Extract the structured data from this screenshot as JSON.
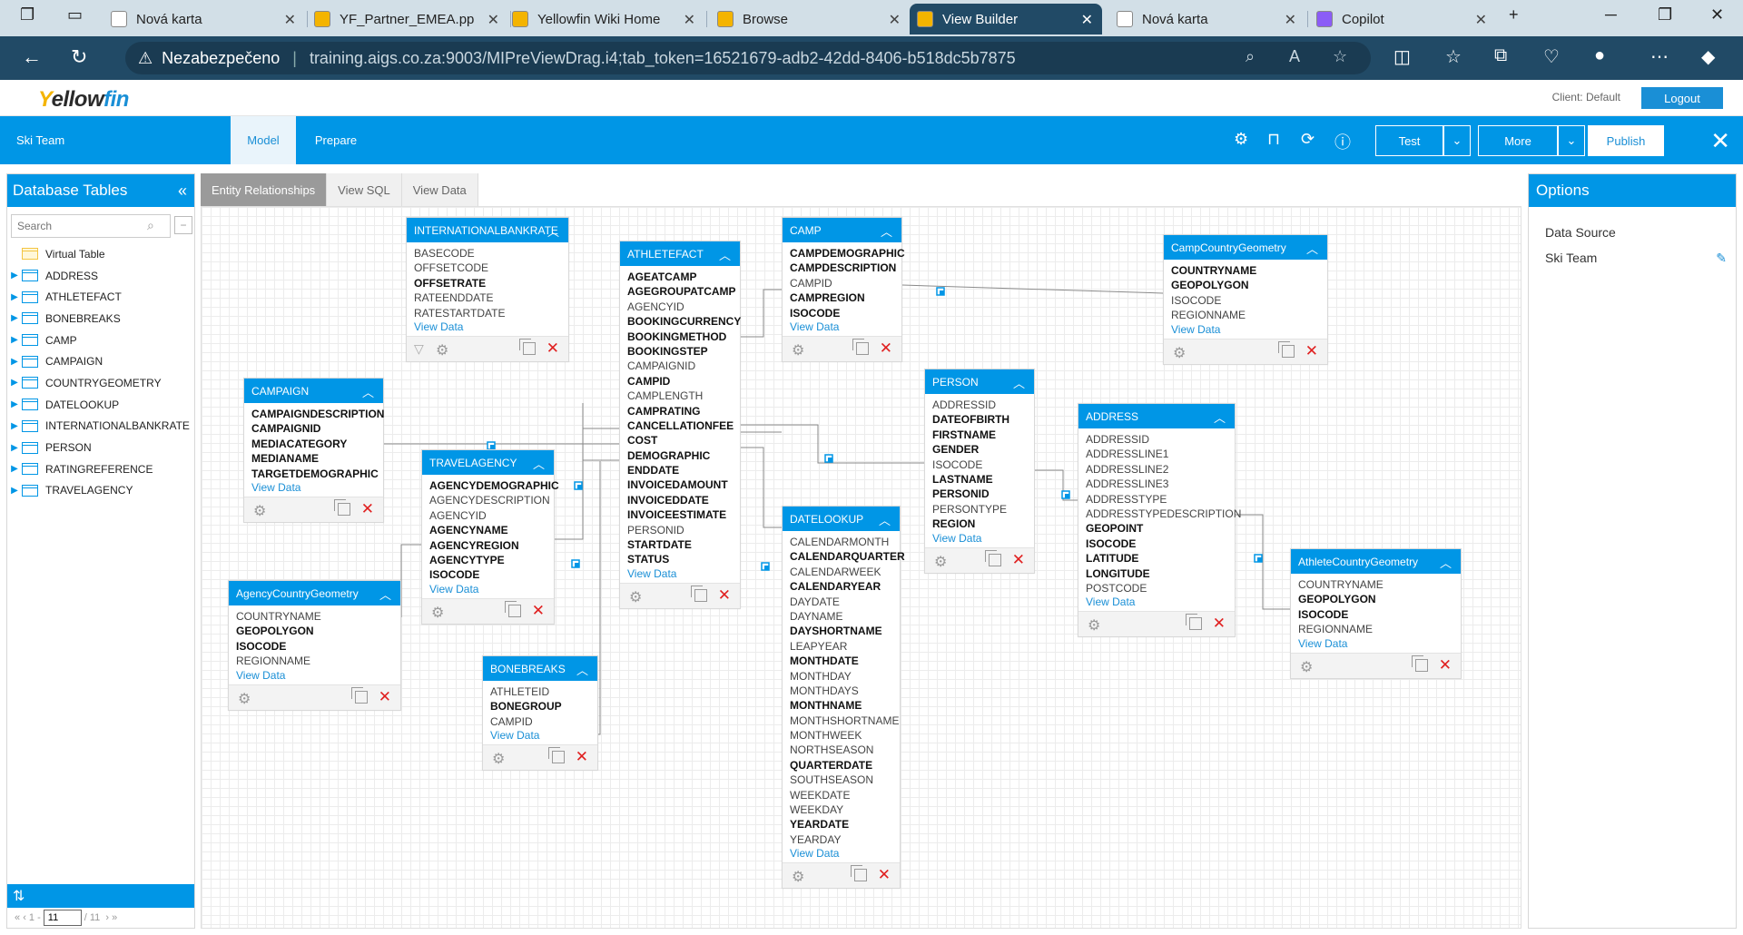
{
  "browser": {
    "tabs": [
      {
        "label": "Nová karta",
        "icon_color": "#ffffff"
      },
      {
        "label": "YF_Partner_EMEA.pp",
        "icon_color": "#f4b400"
      },
      {
        "label": "Yellowfin Wiki Home",
        "icon_color": "#f4b400"
      },
      {
        "label": "Browse",
        "icon_color": "#f4b400"
      },
      {
        "label": "View Builder",
        "icon_color": "#f4b400"
      },
      {
        "label": "Nová karta",
        "icon_color": "#ffffff"
      },
      {
        "label": "Copilot",
        "icon_color": "#8b5cf6"
      }
    ],
    "active_tab": 4,
    "security_label": "Nezabezpečeno",
    "url": "training.aigs.co.za:9003/MIPreViewDrag.i4;tab_token=16521679-adb2-42dd-8406-b518dc5b7875"
  },
  "app": {
    "logo_parts": [
      "Y",
      "ellow",
      "fin"
    ],
    "client_label": "Client: Default",
    "logout_label": "Logout",
    "view_name": "Ski Team",
    "tabs": [
      "Model",
      "Prepare"
    ],
    "active_tab": 0,
    "buttons": {
      "test": "Test",
      "more": "More",
      "publish": "Publish"
    }
  },
  "left_panel": {
    "title": "Database Tables",
    "search_placeholder": "Search",
    "items": [
      {
        "label": "Virtual Table",
        "folder": true
      },
      {
        "label": "ADDRESS"
      },
      {
        "label": "ATHLETEFACT"
      },
      {
        "label": "BONEBREAKS"
      },
      {
        "label": "CAMP"
      },
      {
        "label": "CAMPAIGN"
      },
      {
        "label": "COUNTRYGEOMETRY"
      },
      {
        "label": "DATELOOKUP"
      },
      {
        "label": "INTERNATIONALBANKRATE"
      },
      {
        "label": "PERSON"
      },
      {
        "label": "RATINGREFERENCE"
      },
      {
        "label": "TRAVELAGENCY"
      }
    ],
    "pager": {
      "page_prefix": "1 -",
      "page_value": "11",
      "page_total": "/ 11"
    }
  },
  "canvas": {
    "view_tabs": [
      "Entity Relationships",
      "View SQL",
      "View Data"
    ],
    "active_view_tab": 0,
    "view_data_label": "View Data",
    "entities": [
      {
        "id": "iban",
        "title": "INTERNATIONALBANKRATE",
        "filter": true,
        "fields": [
          [
            "BASECODE",
            0
          ],
          [
            "OFFSETCODE",
            0
          ],
          [
            "OFFSETRATE",
            1
          ],
          [
            "RATEENDDATE",
            0
          ],
          [
            "RATESTARTDATE",
            0
          ]
        ]
      },
      {
        "id": "athletefact",
        "title": "ATHLETEFACT",
        "fields": [
          [
            "AGEATCAMP",
            1
          ],
          [
            "AGEGROUPATCAMP",
            1
          ],
          [
            "AGENCYID",
            0
          ],
          [
            "BOOKINGCURRENCY",
            1
          ],
          [
            "BOOKINGMETHOD",
            1
          ],
          [
            "BOOKINGSTEP",
            1
          ],
          [
            "CAMPAIGNID",
            0
          ],
          [
            "CAMPID",
            1
          ],
          [
            "CAMPLENGTH",
            0
          ],
          [
            "CAMPRATING",
            1
          ],
          [
            "CANCELLATIONFEE",
            1
          ],
          [
            "COST",
            1
          ],
          [
            "DEMOGRAPHIC",
            1
          ],
          [
            "ENDDATE",
            1
          ],
          [
            "INVOICEDAMOUNT",
            1
          ],
          [
            "INVOICEDDATE",
            1
          ],
          [
            "INVOICEESTIMATE",
            1
          ],
          [
            "PERSONID",
            0
          ],
          [
            "STARTDATE",
            1
          ],
          [
            "STATUS",
            1
          ]
        ]
      },
      {
        "id": "camp",
        "title": "CAMP",
        "fields": [
          [
            "CAMPDEMOGRAPHIC",
            1
          ],
          [
            "CAMPDESCRIPTION",
            1
          ],
          [
            "CAMPID",
            0
          ],
          [
            "CAMPREGION",
            1
          ],
          [
            "ISOCODE",
            1
          ]
        ]
      },
      {
        "id": "campcountry",
        "title": "CampCountryGeometry",
        "fields": [
          [
            "COUNTRYNAME",
            1
          ],
          [
            "GEOPOLYGON",
            1
          ],
          [
            "ISOCODE",
            0
          ],
          [
            "REGIONNAME",
            0
          ]
        ]
      },
      {
        "id": "campaign",
        "title": "CAMPAIGN",
        "fields": [
          [
            "CAMPAIGNDESCRIPTION",
            1
          ],
          [
            "CAMPAIGNID",
            1
          ],
          [
            "MEDIACATEGORY",
            1
          ],
          [
            "MEDIANAME",
            1
          ],
          [
            "TARGETDEMOGRAPHIC",
            1
          ]
        ]
      },
      {
        "id": "person",
        "title": "PERSON",
        "fields": [
          [
            "ADDRESSID",
            0
          ],
          [
            "DATEOFBIRTH",
            1
          ],
          [
            "FIRSTNAME",
            1
          ],
          [
            "GENDER",
            1
          ],
          [
            "ISOCODE",
            0
          ],
          [
            "LASTNAME",
            1
          ],
          [
            "PERSONID",
            1
          ],
          [
            "PERSONTYPE",
            0
          ],
          [
            "REGION",
            1
          ]
        ]
      },
      {
        "id": "address",
        "title": "ADDRESS",
        "fields": [
          [
            "ADDRESSID",
            0
          ],
          [
            "ADDRESSLINE1",
            0
          ],
          [
            "ADDRESSLINE2",
            0
          ],
          [
            "ADDRESSLINE3",
            0
          ],
          [
            "ADDRESSTYPE",
            0
          ],
          [
            "ADDRESSTYPEDESCRIPTION",
            0
          ],
          [
            "GEOPOINT",
            1
          ],
          [
            "ISOCODE",
            1
          ],
          [
            "LATITUDE",
            1
          ],
          [
            "LONGITUDE",
            1
          ],
          [
            "POSTCODE",
            0
          ]
        ]
      },
      {
        "id": "travelagency",
        "title": "TRAVELAGENCY",
        "fields": [
          [
            "AGENCYDEMOGRAPHIC",
            1
          ],
          [
            "AGENCYDESCRIPTION",
            0
          ],
          [
            "AGENCYID",
            0
          ],
          [
            "AGENCYNAME",
            1
          ],
          [
            "AGENCYREGION",
            1
          ],
          [
            "AGENCYTYPE",
            1
          ],
          [
            "ISOCODE",
            1
          ]
        ]
      },
      {
        "id": "datelookup",
        "title": "DATELOOKUP",
        "fields": [
          [
            "CALENDARMONTH",
            0
          ],
          [
            "CALENDARQUARTER",
            1
          ],
          [
            "CALENDARWEEK",
            0
          ],
          [
            "CALENDARYEAR",
            1
          ],
          [
            "DAYDATE",
            0
          ],
          [
            "DAYNAME",
            0
          ],
          [
            "DAYSHORTNAME",
            1
          ],
          [
            "LEAPYEAR",
            0
          ],
          [
            "MONTHDATE",
            1
          ],
          [
            "MONTHDAY",
            0
          ],
          [
            "MONTHDAYS",
            0
          ],
          [
            "MONTHNAME",
            1
          ],
          [
            "MONTHSHORTNAME",
            0
          ],
          [
            "MONTHWEEK",
            0
          ],
          [
            "NORTHSEASON",
            0
          ],
          [
            "QUARTERDATE",
            1
          ],
          [
            "SOUTHSEASON",
            0
          ],
          [
            "WEEKDATE",
            0
          ],
          [
            "WEEKDAY",
            0
          ],
          [
            "YEARDATE",
            1
          ],
          [
            "YEARDAY",
            0
          ]
        ]
      },
      {
        "id": "athletecountry",
        "title": "AthleteCountryGeometry",
        "fields": [
          [
            "COUNTRYNAME",
            0
          ],
          [
            "GEOPOLYGON",
            1
          ],
          [
            "ISOCODE",
            1
          ],
          [
            "REGIONNAME",
            0
          ]
        ]
      },
      {
        "id": "agencycountry",
        "title": "AgencyCountryGeometry",
        "fields": [
          [
            "COUNTRYNAME",
            0
          ],
          [
            "GEOPOLYGON",
            1
          ],
          [
            "ISOCODE",
            1
          ],
          [
            "REGIONNAME",
            0
          ]
        ]
      },
      {
        "id": "bonebreaks",
        "title": "BONEBREAKS",
        "fields": [
          [
            "ATHLETEID",
            0
          ],
          [
            "BONEGROUP",
            1
          ],
          [
            "CAMPID",
            0
          ]
        ]
      }
    ]
  },
  "right_panel": {
    "title": "Options",
    "items": [
      "Data Source",
      "Ski Team"
    ]
  },
  "colors": {
    "accent": "#0096e6",
    "browser_dark": "#214a66",
    "delete_red": "#e02020"
  }
}
